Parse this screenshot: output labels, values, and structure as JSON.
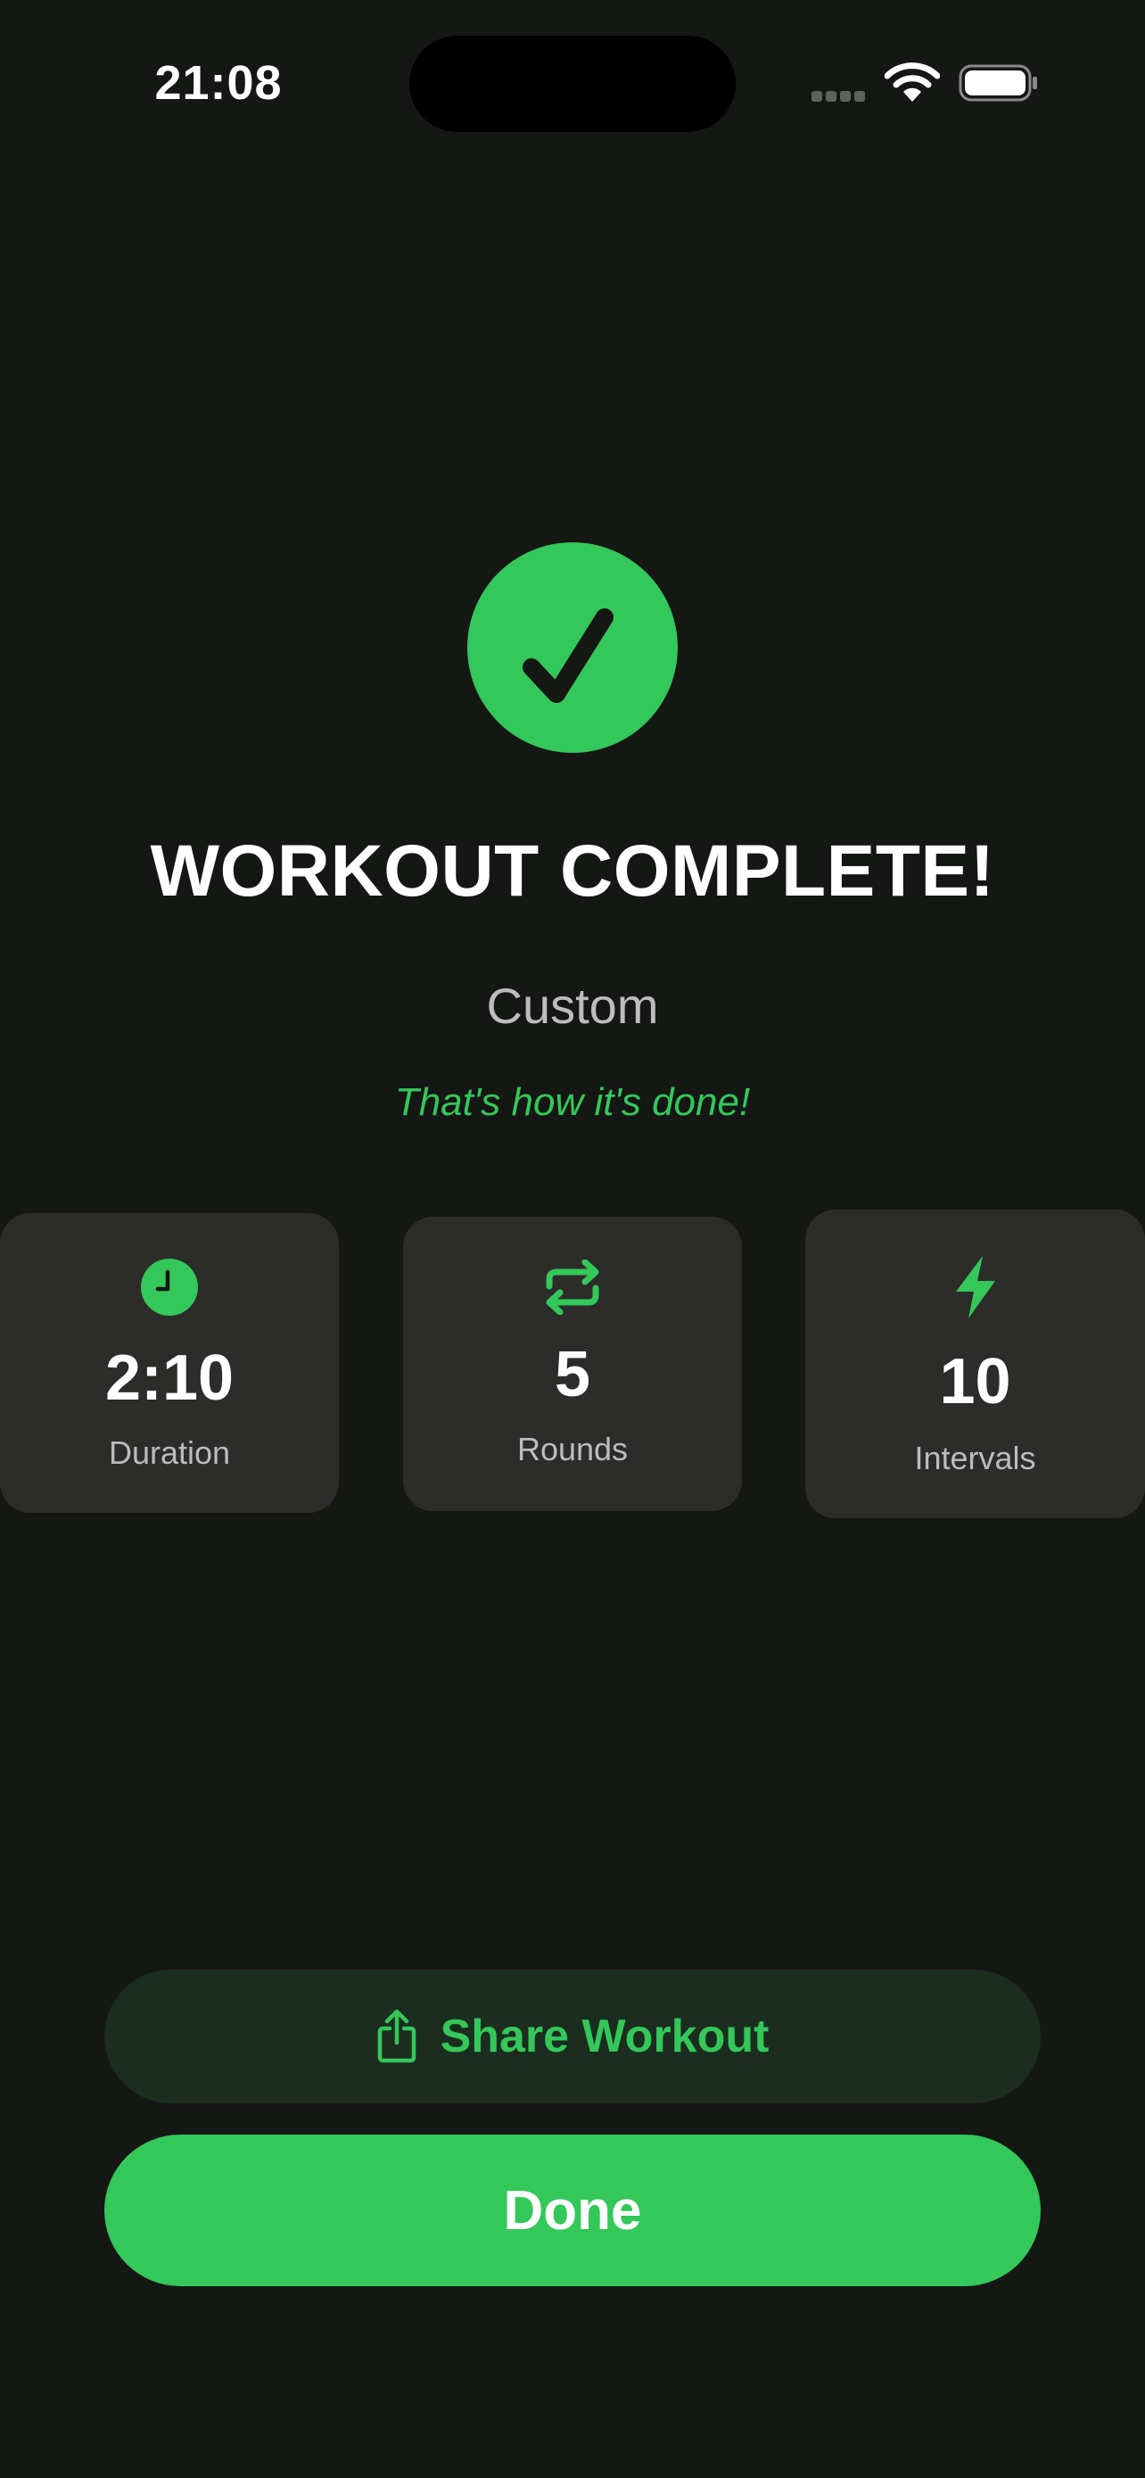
{
  "status_bar": {
    "time": "21:08",
    "icons": [
      "cellular-signal-icon",
      "wifi-icon",
      "battery-icon"
    ]
  },
  "header": {
    "icon": "checkmark-circle-icon",
    "title": "WORKOUT COMPLETE!",
    "workout_name": "Custom",
    "tagline": "That's how it's done!"
  },
  "stats": [
    {
      "icon": "clock-icon",
      "value": "2:10",
      "label": "Duration"
    },
    {
      "icon": "repeat-icon",
      "value": "5",
      "label": "Rounds"
    },
    {
      "icon": "bolt-icon",
      "value": "10",
      "label": "Intervals"
    }
  ],
  "actions": {
    "share_label": "Share Workout",
    "share_icon": "share-icon",
    "done_label": "Done"
  },
  "colors": {
    "accent": "#34c759",
    "background": "#151715",
    "card": "#2c2d2b"
  }
}
